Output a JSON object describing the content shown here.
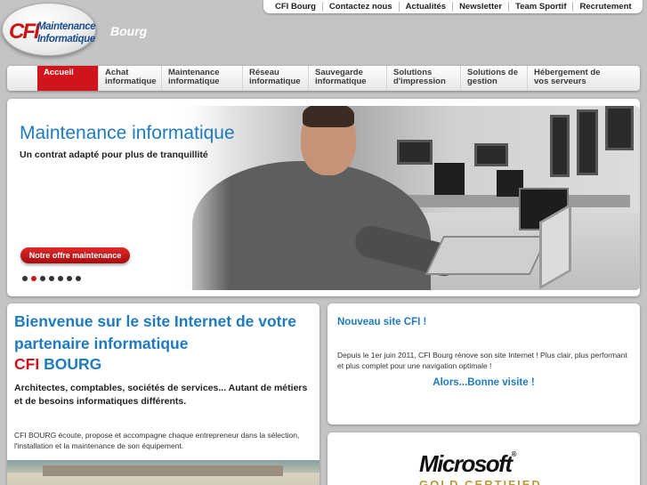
{
  "logo": {
    "mark": "CFI",
    "line1": "Maintenance",
    "line2": "Informatique"
  },
  "city": "Bourg",
  "top_links": [
    "CFI Bourg",
    "Contactez nous",
    "Actualités",
    "Newsletter",
    "Team Sportif",
    "Recrutement"
  ],
  "nav": [
    {
      "line1": "Accueil",
      "line2": "",
      "active": true
    },
    {
      "line1": "Achat",
      "line2": "informatique"
    },
    {
      "line1": "Maintenance",
      "line2": "informatique"
    },
    {
      "line1": "Réseau",
      "line2": "informatique"
    },
    {
      "line1": "Sauvegarde",
      "line2": "informatique"
    },
    {
      "line1": "Solutions",
      "line2": "d'impression"
    },
    {
      "line1": "Solutions de",
      "line2": "gestion"
    },
    {
      "line1": "Hébergement de",
      "line2": "vos serveurs"
    }
  ],
  "banner": {
    "title": "Maintenance informatique",
    "subtitle": "Un contrat adapté pour plus de tranquillité",
    "button": "Notre offre maintenance",
    "slide_count": 7,
    "active_slide": 2
  },
  "welcome": {
    "title": "Bienvenue sur le site Internet de votre partenaire informatique",
    "cfi": "CFI",
    "bourg": "BOURG",
    "lead": "Architectes, comptables, sociétés de services... Autant de métiers et de besoins informatiques différents.",
    "body": "CFI BOURG écoute, propose et accompagne chaque entrepreneur dans la sélection, l'installation et la maintenance de son équipement."
  },
  "news": {
    "title": "Nouveau site CFI !",
    "body": "Depuis le 1er juin 2011, CFI Bourg rénove son site Internet ! Plus clair, plus performant et plus complet pour une navigation optimale !",
    "cta": "Alors...Bonne visite !"
  },
  "partner": {
    "name": "Microsoft",
    "reg": "®",
    "badge": "GOLD CERTIFIED"
  },
  "colors": {
    "accent_red": "#d0141b",
    "accent_blue": "#1f7bbf",
    "background": "#c4c4c4"
  }
}
